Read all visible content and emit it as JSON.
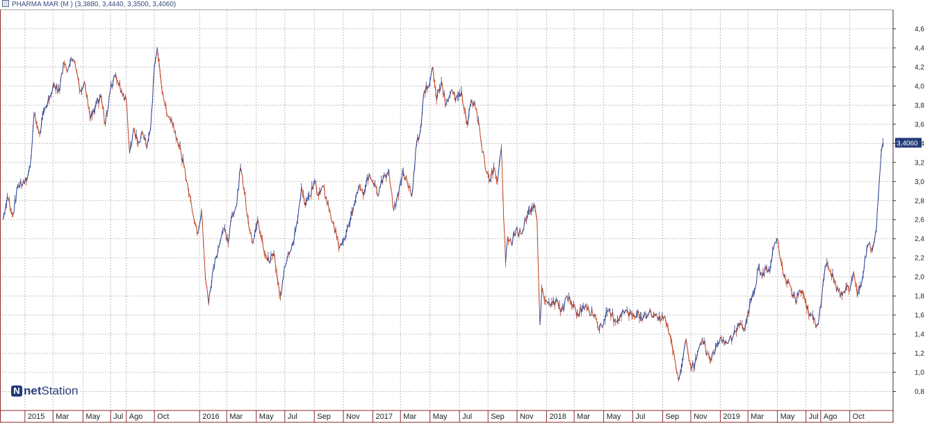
{
  "header": {
    "legend_text": "PHARMA MAR (M ) (3,3880, 3,4440, 3,3500, 3,4060)"
  },
  "logo": {
    "icon": "netstation-logo-icon",
    "brand_bold": "net",
    "brand_rest": "Station"
  },
  "colors": {
    "up": "#2b3f8f",
    "down": "#c0401f",
    "price_tag_bg": "#233a78",
    "grid": "#bdbdbd",
    "frame": "#8b2a2a"
  },
  "chart_data": {
    "type": "line",
    "title": "PHARMA MAR (M )",
    "ohlc_last": {
      "open": "3,3880",
      "high": "3,4440",
      "low": "3,3500",
      "close": "3,4060"
    },
    "last_price_label": "3,4060",
    "y_ticks": [
      "4,6",
      "4,4",
      "4,2",
      "4,0",
      "3,8",
      "3,6",
      "3,4",
      "3,2",
      "3,0",
      "2,8",
      "2,6",
      "2,4",
      "2,2",
      "2,0",
      "1,8",
      "1,6",
      "1,4",
      "1,2",
      "1,0",
      "0,8"
    ],
    "ylim": [
      0.6,
      4.8
    ],
    "xlim": [
      "2014-11-15",
      "2019-12-31"
    ],
    "grid": true,
    "x_ticks": [
      {
        "label": "2015",
        "date": "2015-01-02"
      },
      {
        "label": "Mar",
        "date": "2015-03-02"
      },
      {
        "label": "May",
        "date": "2015-05-04"
      },
      {
        "label": "Jul",
        "date": "2015-07-01"
      },
      {
        "label": "Ago",
        "date": "2015-08-03"
      },
      {
        "label": "Oct",
        "date": "2015-10-01"
      },
      {
        "label": "2016",
        "date": "2016-01-04"
      },
      {
        "label": "Mar",
        "date": "2016-03-01"
      },
      {
        "label": "May",
        "date": "2016-05-02"
      },
      {
        "label": "Jul",
        "date": "2016-07-01"
      },
      {
        "label": "Sep",
        "date": "2016-09-01"
      },
      {
        "label": "Nov",
        "date": "2016-11-01"
      },
      {
        "label": "2017",
        "date": "2017-01-02"
      },
      {
        "label": "Mar",
        "date": "2017-03-01"
      },
      {
        "label": "May",
        "date": "2017-05-02"
      },
      {
        "label": "Jul",
        "date": "2017-07-03"
      },
      {
        "label": "Sep",
        "date": "2017-09-01"
      },
      {
        "label": "Nov",
        "date": "2017-11-01"
      },
      {
        "label": "2018",
        "date": "2018-01-02"
      },
      {
        "label": "Mar",
        "date": "2018-03-01"
      },
      {
        "label": "May",
        "date": "2018-05-02"
      },
      {
        "label": "Jul",
        "date": "2018-07-02"
      },
      {
        "label": "Sep",
        "date": "2018-09-03"
      },
      {
        "label": "Nov",
        "date": "2018-11-01"
      },
      {
        "label": "2019",
        "date": "2019-01-02"
      },
      {
        "label": "Mar",
        "date": "2019-03-01"
      },
      {
        "label": "May",
        "date": "2019-05-02"
      },
      {
        "label": "Jul",
        "date": "2019-07-01"
      },
      {
        "label": "Ago",
        "date": "2019-08-01"
      },
      {
        "label": "Oct",
        "date": "2019-10-01"
      }
    ],
    "series": [
      {
        "points": [
          [
            "2014-11-17",
            2.6
          ],
          [
            "2014-11-26",
            2.85
          ],
          [
            "2014-12-08",
            2.65
          ],
          [
            "2014-12-18",
            2.95
          ],
          [
            "2015-01-05",
            3.0
          ],
          [
            "2015-01-13",
            3.15
          ],
          [
            "2015-01-21",
            3.7
          ],
          [
            "2015-02-02",
            3.5
          ],
          [
            "2015-02-12",
            3.75
          ],
          [
            "2015-02-24",
            3.9
          ],
          [
            "2015-03-06",
            4.0
          ],
          [
            "2015-03-16",
            3.95
          ],
          [
            "2015-03-24",
            4.25
          ],
          [
            "2015-04-01",
            4.15
          ],
          [
            "2015-04-09",
            4.3
          ],
          [
            "2015-04-17",
            4.25
          ],
          [
            "2015-04-27",
            3.95
          ],
          [
            "2015-05-07",
            4.05
          ],
          [
            "2015-05-19",
            3.65
          ],
          [
            "2015-05-29",
            3.75
          ],
          [
            "2015-06-10",
            3.9
          ],
          [
            "2015-06-20",
            3.6
          ],
          [
            "2015-06-30",
            3.95
          ],
          [
            "2015-07-08",
            4.1
          ],
          [
            "2015-07-16",
            4.05
          ],
          [
            "2015-07-24",
            3.95
          ],
          [
            "2015-08-03",
            3.85
          ],
          [
            "2015-08-10",
            3.3
          ],
          [
            "2015-08-18",
            3.55
          ],
          [
            "2015-08-28",
            3.4
          ],
          [
            "2015-09-07",
            3.5
          ],
          [
            "2015-09-15",
            3.35
          ],
          [
            "2015-09-23",
            3.55
          ],
          [
            "2015-10-01",
            4.2
          ],
          [
            "2015-10-07",
            4.4
          ],
          [
            "2015-10-15",
            4.05
          ],
          [
            "2015-10-27",
            3.7
          ],
          [
            "2015-11-06",
            3.65
          ],
          [
            "2015-11-18",
            3.45
          ],
          [
            "2015-11-26",
            3.3
          ],
          [
            "2015-12-08",
            3.0
          ],
          [
            "2015-12-18",
            2.75
          ],
          [
            "2015-12-30",
            2.45
          ],
          [
            "2016-01-08",
            2.7
          ],
          [
            "2016-01-16",
            2.0
          ],
          [
            "2016-01-23",
            1.72
          ],
          [
            "2016-02-02",
            2.1
          ],
          [
            "2016-02-12",
            2.3
          ],
          [
            "2016-02-24",
            2.5
          ],
          [
            "2016-03-04",
            2.35
          ],
          [
            "2016-03-12",
            2.65
          ],
          [
            "2016-03-22",
            2.75
          ],
          [
            "2016-03-30",
            3.15
          ],
          [
            "2016-04-07",
            2.9
          ],
          [
            "2016-04-15",
            2.6
          ],
          [
            "2016-04-25",
            2.35
          ],
          [
            "2016-05-05",
            2.6
          ],
          [
            "2016-05-17",
            2.3
          ],
          [
            "2016-05-29",
            2.15
          ],
          [
            "2016-06-08",
            2.25
          ],
          [
            "2016-06-16",
            1.95
          ],
          [
            "2016-06-22",
            1.8
          ],
          [
            "2016-06-30",
            2.1
          ],
          [
            "2016-07-08",
            2.25
          ],
          [
            "2016-07-18",
            2.35
          ],
          [
            "2016-07-28",
            2.6
          ],
          [
            "2016-08-05",
            2.95
          ],
          [
            "2016-08-13",
            2.75
          ],
          [
            "2016-08-23",
            2.85
          ],
          [
            "2016-09-02",
            3.0
          ],
          [
            "2016-09-10",
            2.85
          ],
          [
            "2016-09-20",
            2.95
          ],
          [
            "2016-10-02",
            2.7
          ],
          [
            "2016-10-12",
            2.55
          ],
          [
            "2016-10-24",
            2.3
          ],
          [
            "2016-11-03",
            2.4
          ],
          [
            "2016-11-13",
            2.55
          ],
          [
            "2016-11-23",
            2.75
          ],
          [
            "2016-12-03",
            2.95
          ],
          [
            "2016-12-13",
            2.85
          ],
          [
            "2016-12-21",
            3.05
          ],
          [
            "2017-01-02",
            3.0
          ],
          [
            "2017-01-12",
            2.85
          ],
          [
            "2017-01-24",
            3.05
          ],
          [
            "2017-02-05",
            3.1
          ],
          [
            "2017-02-15",
            2.7
          ],
          [
            "2017-02-25",
            2.85
          ],
          [
            "2017-03-05",
            3.1
          ],
          [
            "2017-03-15",
            3.0
          ],
          [
            "2017-03-25",
            2.85
          ],
          [
            "2017-04-04",
            3.4
          ],
          [
            "2017-04-12",
            3.55
          ],
          [
            "2017-04-20",
            3.95
          ],
          [
            "2017-04-30",
            4.0
          ],
          [
            "2017-05-08",
            4.2
          ],
          [
            "2017-05-16",
            3.85
          ],
          [
            "2017-05-26",
            4.05
          ],
          [
            "2017-06-05",
            3.8
          ],
          [
            "2017-06-15",
            3.95
          ],
          [
            "2017-06-25",
            3.85
          ],
          [
            "2017-07-07",
            3.95
          ],
          [
            "2017-07-19",
            3.6
          ],
          [
            "2017-07-29",
            3.85
          ],
          [
            "2017-08-08",
            3.75
          ],
          [
            "2017-08-18",
            3.4
          ],
          [
            "2017-08-28",
            3.1
          ],
          [
            "2017-09-05",
            3.0
          ],
          [
            "2017-09-13",
            3.15
          ],
          [
            "2017-09-21",
            3.0
          ],
          [
            "2017-09-29",
            3.35
          ],
          [
            "2017-10-04",
            2.6
          ],
          [
            "2017-10-08",
            2.15
          ],
          [
            "2017-10-12",
            2.4
          ],
          [
            "2017-10-20",
            2.35
          ],
          [
            "2017-10-30",
            2.5
          ],
          [
            "2017-11-09",
            2.45
          ],
          [
            "2017-11-19",
            2.6
          ],
          [
            "2017-11-27",
            2.7
          ],
          [
            "2017-12-07",
            2.75
          ],
          [
            "2017-12-13",
            2.6
          ],
          [
            "2017-12-19",
            1.5
          ],
          [
            "2017-12-23",
            1.88
          ],
          [
            "2017-12-30",
            1.75
          ],
          [
            "2018-01-11",
            1.7
          ],
          [
            "2018-01-21",
            1.75
          ],
          [
            "2018-02-02",
            1.65
          ],
          [
            "2018-02-14",
            1.8
          ],
          [
            "2018-02-24",
            1.7
          ],
          [
            "2018-03-08",
            1.62
          ],
          [
            "2018-03-20",
            1.7
          ],
          [
            "2018-04-01",
            1.65
          ],
          [
            "2018-04-13",
            1.6
          ],
          [
            "2018-04-23",
            1.45
          ],
          [
            "2018-05-03",
            1.55
          ],
          [
            "2018-05-13",
            1.65
          ],
          [
            "2018-05-25",
            1.55
          ],
          [
            "2018-06-06",
            1.6
          ],
          [
            "2018-06-18",
            1.65
          ],
          [
            "2018-06-30",
            1.6
          ],
          [
            "2018-07-12",
            1.62
          ],
          [
            "2018-07-24",
            1.58
          ],
          [
            "2018-08-05",
            1.62
          ],
          [
            "2018-08-17",
            1.6
          ],
          [
            "2018-08-29",
            1.55
          ],
          [
            "2018-09-08",
            1.58
          ],
          [
            "2018-09-18",
            1.4
          ],
          [
            "2018-09-28",
            1.15
          ],
          [
            "2018-10-06",
            0.92
          ],
          [
            "2018-10-14",
            1.1
          ],
          [
            "2018-10-22",
            1.35
          ],
          [
            "2018-10-30",
            1.1
          ],
          [
            "2018-11-07",
            1.05
          ],
          [
            "2018-11-15",
            1.2
          ],
          [
            "2018-11-25",
            1.35
          ],
          [
            "2018-12-05",
            1.2
          ],
          [
            "2018-12-15",
            1.15
          ],
          [
            "2018-12-27",
            1.3
          ],
          [
            "2019-01-08",
            1.35
          ],
          [
            "2019-01-18",
            1.3
          ],
          [
            "2019-01-30",
            1.4
          ],
          [
            "2019-02-09",
            1.5
          ],
          [
            "2019-02-19",
            1.45
          ],
          [
            "2019-02-27",
            1.55
          ],
          [
            "2019-03-07",
            1.75
          ],
          [
            "2019-03-15",
            1.85
          ],
          [
            "2019-03-23",
            2.1
          ],
          [
            "2019-03-31",
            2.0
          ],
          [
            "2019-04-08",
            2.1
          ],
          [
            "2019-04-16",
            2.05
          ],
          [
            "2019-04-24",
            2.3
          ],
          [
            "2019-05-02",
            2.4
          ],
          [
            "2019-05-10",
            2.15
          ],
          [
            "2019-05-20",
            1.95
          ],
          [
            "2019-05-30",
            1.9
          ],
          [
            "2019-06-09",
            1.75
          ],
          [
            "2019-06-19",
            1.85
          ],
          [
            "2019-06-29",
            1.75
          ],
          [
            "2019-07-09",
            1.6
          ],
          [
            "2019-07-17",
            1.55
          ],
          [
            "2019-07-25",
            1.5
          ],
          [
            "2019-08-02",
            1.7
          ],
          [
            "2019-08-08",
            2.0
          ],
          [
            "2019-08-14",
            2.15
          ],
          [
            "2019-08-22",
            2.05
          ],
          [
            "2019-08-30",
            1.95
          ],
          [
            "2019-09-07",
            1.85
          ],
          [
            "2019-09-15",
            1.8
          ],
          [
            "2019-09-23",
            1.9
          ],
          [
            "2019-10-01",
            1.85
          ],
          [
            "2019-10-09",
            2.05
          ],
          [
            "2019-10-17",
            1.8
          ],
          [
            "2019-10-25",
            1.9
          ],
          [
            "2019-11-02",
            2.2
          ],
          [
            "2019-11-10",
            2.35
          ],
          [
            "2019-11-18",
            2.3
          ],
          [
            "2019-11-26",
            2.5
          ],
          [
            "2019-12-02",
            3.0
          ],
          [
            "2019-12-06",
            3.3
          ],
          [
            "2019-12-10",
            3.406
          ]
        ]
      }
    ]
  }
}
